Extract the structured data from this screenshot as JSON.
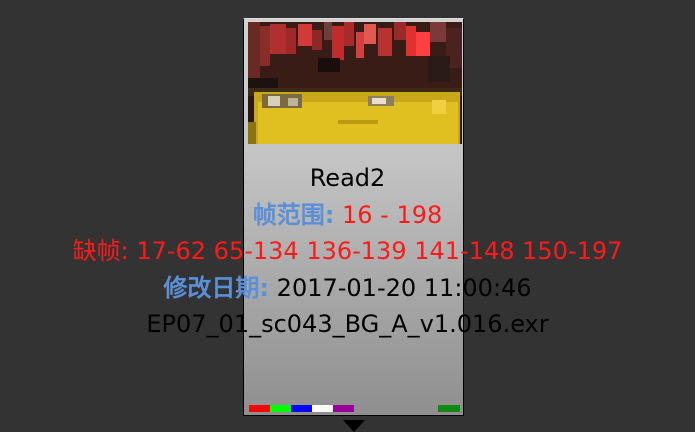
{
  "node": {
    "name": "Read2",
    "frame_range_label": "帧范围:",
    "frame_range_value": "16 - 198",
    "missing_frames_label": "缺帧:",
    "missing_frames_value": "17-62 65-134 136-139 141-148 150-197",
    "modified_label": "修改日期:",
    "modified_value": "2017-01-20 11:00:46",
    "filename": "EP07_01_sc043_BG_A_v1.016.exr"
  },
  "colors": {
    "canvas_bg": "#333333",
    "label_blue": "#5b8fd6",
    "value_red": "#ff1a1a",
    "swatches": [
      "#ff0000",
      "#00ff00",
      "#0000ff",
      "#ffffff",
      "#990099"
    ],
    "swatch_right": "#118811"
  },
  "icons": {
    "output_arrow": "triangle-down-icon"
  }
}
